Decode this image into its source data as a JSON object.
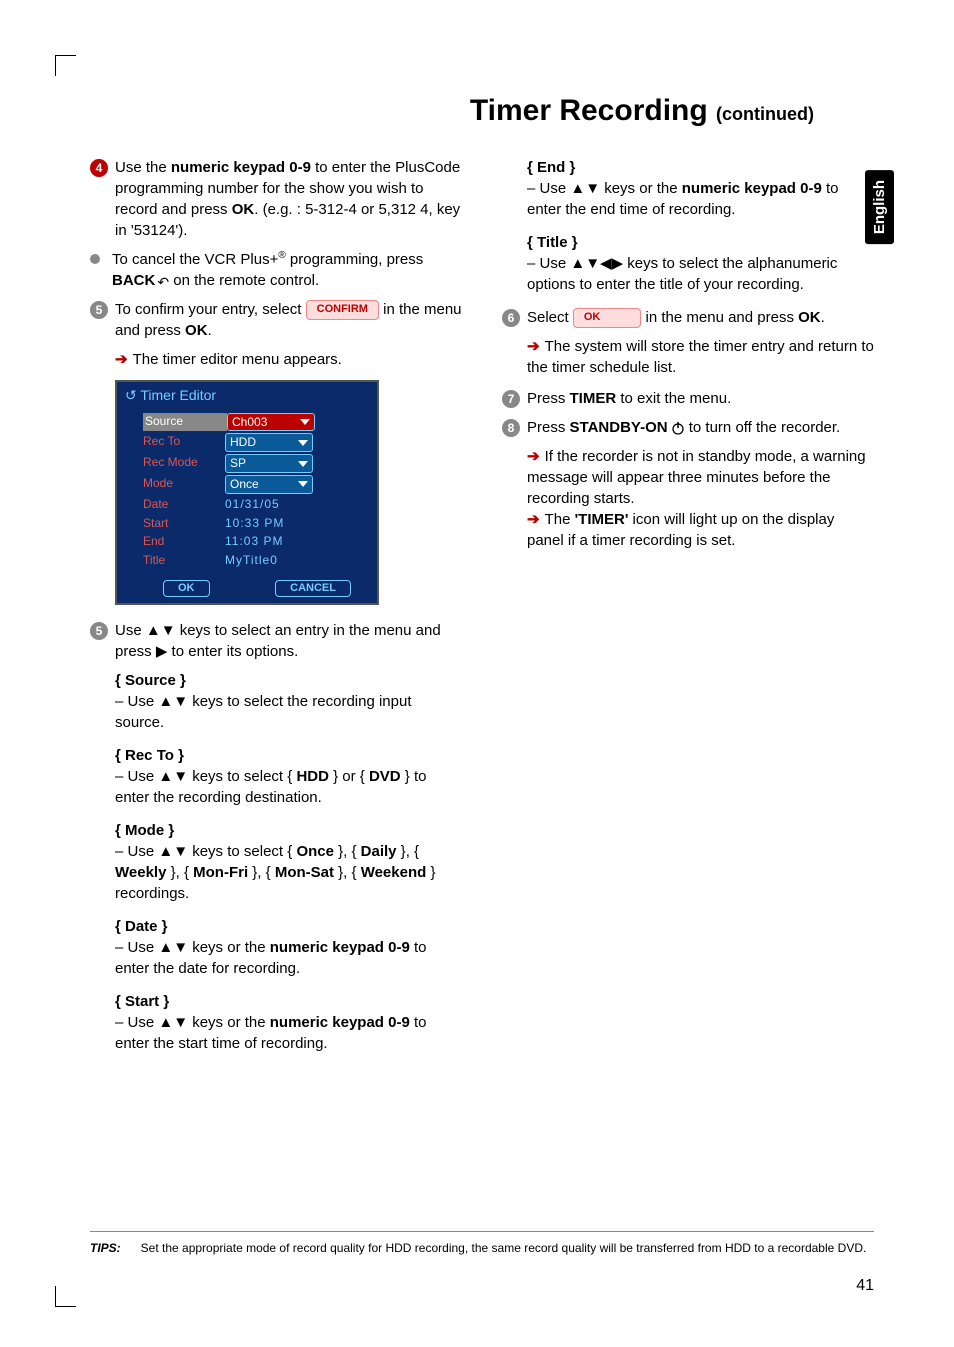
{
  "page": {
    "title_main": "Timer Recording ",
    "title_cont": "(continued)",
    "side_tab": "English",
    "page_number": "41"
  },
  "left": {
    "step4": {
      "pre": "Use the ",
      "key": "numeric keypad 0-9",
      "post": " to enter the PlusCode programming number for the show you wish to record and press ",
      "ok": "OK",
      "example": ". (e.g. : 5-312-4 or 5,312 4, key in '53124')."
    },
    "cancel": {
      "pre": "To cancel the VCR Plus+",
      "sup": "®",
      "mid": " programming, press ",
      "back": "BACK",
      "post": " on the remote control."
    },
    "step5a": {
      "pre": "To confirm your entry, select ",
      "pill": "CONFIRM",
      "post_a": " in the menu and press ",
      "ok": "OK",
      "post_b": ".",
      "result": "The timer editor menu appears."
    },
    "panel": {
      "title": "Timer Editor",
      "rows": [
        {
          "label": "Source",
          "value": "Ch003",
          "sel": true
        },
        {
          "label": "Rec To",
          "value": "HDD"
        },
        {
          "label": "Rec Mode",
          "value": "SP"
        },
        {
          "label": "Mode",
          "value": "Once"
        }
      ],
      "plain_rows": [
        {
          "label": "Date",
          "value": "01/31/05"
        },
        {
          "label": "Start",
          "value": "10:33 PM"
        },
        {
          "label": "End",
          "value": "11:03 PM"
        },
        {
          "label": "Title",
          "value": "MyTitle0"
        }
      ],
      "btn_ok": "OK",
      "btn_cancel": "CANCEL"
    },
    "step5b": {
      "pre": "Use ▲▼ keys to select an entry in the menu and press ▶ to enter its options."
    },
    "source": {
      "header": "{ Source }",
      "body": "–   Use ▲▼ keys to select the recording input source."
    },
    "recto": {
      "header": "{ Rec To }",
      "pre": "–   Use ▲▼ keys to select { ",
      "hdd": "HDD",
      "mid": " } or { ",
      "dvd": "DVD",
      "post": " } to enter the recording destination."
    },
    "mode": {
      "header": "{ Mode }",
      "pre": "–   Use ▲▼ keys to select { ",
      "once": "Once",
      "seg1": " }, { ",
      "daily": "Daily",
      "seg2": " }, { ",
      "weekly": "Weekly",
      "seg3": " }, { ",
      "monfri": "Mon-Fri",
      "seg4": " }, { ",
      "monsat": "Mon-Sat",
      "seg5": " }, { ",
      "weekend": "Weekend",
      "post": " } recordings."
    },
    "date": {
      "header": "{ Date }",
      "pre": "–   Use ▲▼ keys or the ",
      "key": "numeric keypad 0-9",
      "post": " to enter the date for recording."
    },
    "start": {
      "header": "{ Start }",
      "pre": "–   Use ▲▼ keys or the ",
      "key": "numeric keypad 0-9",
      "post": " to enter the start time of recording."
    }
  },
  "right": {
    "end": {
      "header": "{ End }",
      "pre": "–   Use ▲▼ keys or the ",
      "key": "numeric keypad 0-9",
      "post": " to enter the end time of recording."
    },
    "titleopt": {
      "header": "{ Title }",
      "body": "–   Use ▲▼◀▶ keys to select the alphanumeric options to enter the title of your recording."
    },
    "step6": {
      "pre": "Select ",
      "pill": "OK",
      "post_a": " in the menu and press ",
      "ok": "OK",
      "post_b": ".",
      "result": "The system will store the timer entry and return to the timer schedule list."
    },
    "step7": {
      "pre": "Press ",
      "timer": "TIMER",
      "post": " to exit the menu."
    },
    "step8": {
      "pre": "Press ",
      "standby": "STANDBY-ON",
      "post": " to turn off the recorder.",
      "result1": "If the recorder is not in standby mode, a warning message will appear three minutes before the recording starts.",
      "result2a": "The ",
      "timer_lbl": "'TIMER'",
      "result2b": " icon will light up on the display panel if a timer recording is set."
    }
  },
  "tips": {
    "label": "TIPS:",
    "text": "Set the appropriate mode of record quality for HDD recording, the same record quality will be transferred from HDD to a recordable DVD."
  }
}
